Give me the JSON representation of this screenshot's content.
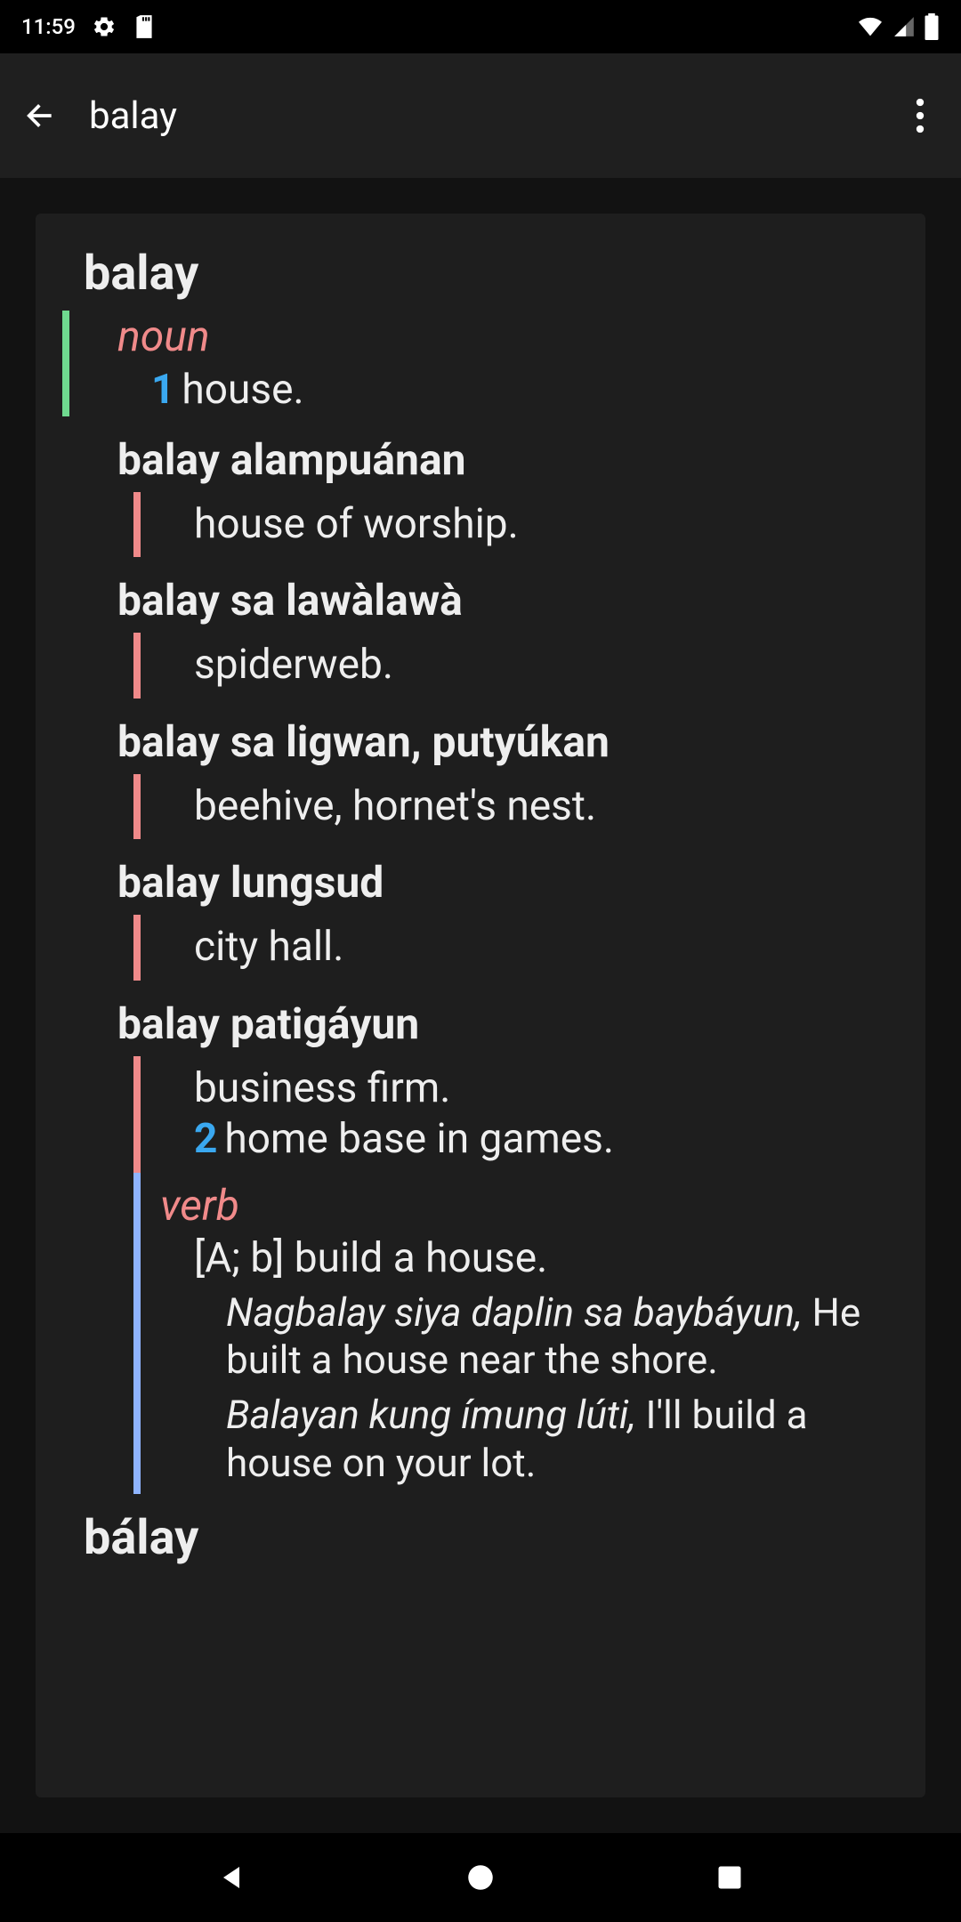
{
  "status": {
    "time": "11:59",
    "icons": {
      "gear": "gear-icon",
      "sd": "sd-icon",
      "wifi": "wifi-icon",
      "signal": "signal-icon",
      "battery": "battery-icon"
    }
  },
  "app": {
    "title": "balay"
  },
  "entry": {
    "headword": "balay",
    "noun": {
      "pos": "noun",
      "def1_num": "1",
      "def1": "house."
    },
    "subs": [
      {
        "head": "balay alampuánan",
        "def": "house of worship."
      },
      {
        "head": "balay sa lawàlawà",
        "def": "spiderweb."
      },
      {
        "head": "balay sa ligwan, putyúkan",
        "def": "beehive, hornet's nest."
      },
      {
        "head": "balay lungsud",
        "def": "city hall."
      },
      {
        "head": "balay patigáyun",
        "def1": "business firm.",
        "def2_num": "2",
        "def2": "home base in games."
      }
    ],
    "verb": {
      "pos": "verb",
      "grammar": "[A; b] build a house.",
      "ex1_src": "Nagbalay siya daplin sa baybáyun,",
      "ex1_gloss": " He built a house near the shore.",
      "ex2_src": "Balayan kung ímung lúti,",
      "ex2_gloss": " I'll build a house on your lot."
    }
  },
  "entry2": {
    "headword": "bálay"
  }
}
